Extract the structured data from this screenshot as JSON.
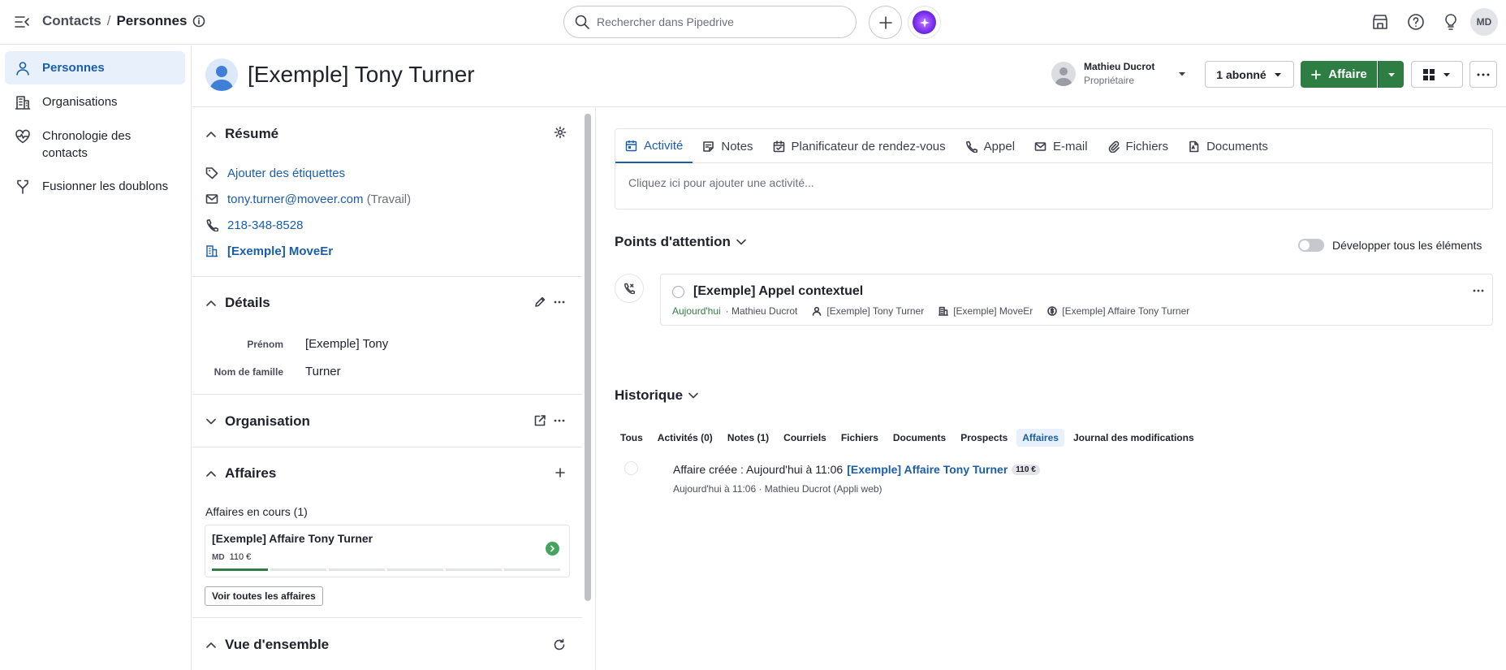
{
  "topbar": {
    "breadcrumb_parent": "Contacts",
    "breadcrumb_sep": "/",
    "breadcrumb_current": "Personnes",
    "search_placeholder": "Rechercher dans Pipedrive",
    "user_initials": "MD"
  },
  "leftnav": {
    "items": [
      {
        "label": "Personnes",
        "icon": "person-icon"
      },
      {
        "label": "Organisations",
        "icon": "building-icon"
      },
      {
        "label": "Chronologie des contacts",
        "icon": "heart-pulse-icon"
      },
      {
        "label": "Fusionner les doublons",
        "icon": "merge-icon"
      }
    ]
  },
  "header": {
    "person_name": "[Exemple] Tony Turner",
    "owner_name": "Mathieu Ducrot",
    "owner_role": "Propriétaire",
    "follower_label": "1 abonné",
    "deal_button_label": "Affaire"
  },
  "summary": {
    "title": "Résumé",
    "add_tags": "Ajouter des étiquettes",
    "email": "tony.turner@moveer.com",
    "email_type": "(Travail)",
    "phone": "218-348-8528",
    "organization": "[Exemple] MoveEr"
  },
  "details": {
    "title": "Détails",
    "first_name_label": "Prénom",
    "first_name_value": "[Exemple] Tony",
    "last_name_label": "Nom de famille",
    "last_name_value": "Turner"
  },
  "organization_section": {
    "title": "Organisation"
  },
  "deals": {
    "title": "Affaires",
    "open_label": "Affaires en cours (1)",
    "card_title": "[Exemple] Affaire Tony Turner",
    "card_owner_initials": "MD",
    "card_value": "110 €",
    "view_all_label": "Voir toutes les affaires"
  },
  "overview": {
    "title": "Vue d'ensemble"
  },
  "main": {
    "tabs": [
      {
        "label": "Activité",
        "icon": "calendar-icon"
      },
      {
        "label": "Notes",
        "icon": "note-icon"
      },
      {
        "label": "Planificateur de rendez-vous",
        "icon": "scheduler-icon"
      },
      {
        "label": "Appel",
        "icon": "phone-icon"
      },
      {
        "label": "E-mail",
        "icon": "mail-icon"
      },
      {
        "label": "Fichiers",
        "icon": "paperclip-icon"
      },
      {
        "label": "Documents",
        "icon": "document-icon"
      }
    ],
    "activity_placeholder": "Cliquez ici pour ajouter une activité...",
    "focus_title": "Points d'attention",
    "expand_all_label": "Développer tous les éléments",
    "focus_item": {
      "title": "[Exemple] Appel contextuel",
      "date": "Aujourd'hui",
      "owner": "· Mathieu Ducrot",
      "person": "[Exemple] Tony Turner",
      "organization": "[Exemple] MoveEr",
      "deal": "[Exemple] Affaire Tony Turner"
    },
    "history_title": "Historique",
    "history_tabs": [
      "Tous",
      "Activités (0)",
      "Notes (1)",
      "Courriels",
      "Fichiers",
      "Documents",
      "Prospects",
      "Affaires",
      "Journal des modifications"
    ],
    "history_entry": {
      "prefix": "Affaire créée : Aujourd'hui à 11:06",
      "deal_link": "[Exemple] Affaire Tony Turner",
      "badge": "110 €",
      "sub": "Aujourd'hui à 11:06 · Mathieu Ducrot (Appli web)"
    }
  },
  "colors": {
    "accent_blue": "#1a5dab",
    "green": "#2e7d43",
    "border": "#e3e4e8"
  }
}
